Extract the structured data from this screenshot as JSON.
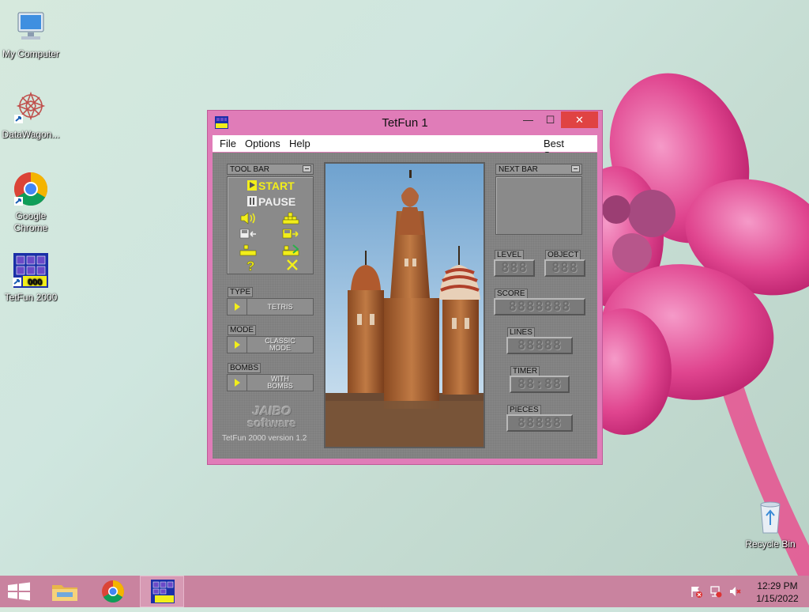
{
  "desktop": {
    "icons": [
      {
        "label": "My Computer"
      },
      {
        "label": "DataWagon..."
      },
      {
        "label": "Google Chrome"
      },
      {
        "label": "TetFun 2000"
      },
      {
        "label": "Recycle Bin"
      }
    ]
  },
  "window": {
    "title": "TetFun 1",
    "app_icon_text": "2000",
    "menu": {
      "file": "File",
      "options": "Options",
      "help": "Help",
      "best_scores": "Best Scores"
    },
    "toolbar": {
      "header": "TOOL BAR",
      "start": "START",
      "pause": "PAUSE",
      "tools": [
        "sound-icon",
        "blocks-icon",
        "load-icon",
        "save-icon",
        "export-icon",
        "import-icon",
        "help-icon",
        "exit-icon"
      ]
    },
    "type": {
      "label": "TYPE",
      "value": "TETRIS"
    },
    "mode": {
      "label": "MODE",
      "value_line1": "CLASSIC",
      "value_line2": "MODE"
    },
    "bombs": {
      "label": "BOMBS",
      "value_line1": "WITH",
      "value_line2": "BOMBS"
    },
    "logo": {
      "line1": "JAIBO",
      "line2": "software"
    },
    "version": "TetFun 2000 version 1.2",
    "next_bar": {
      "header": "NEXT BAR"
    },
    "stats": {
      "level": {
        "label": "LEVEL",
        "display": "888"
      },
      "object": {
        "label": "OBJECT",
        "display": "888"
      },
      "score": {
        "label": "SCORE",
        "display": "8888888"
      },
      "lines": {
        "label": "LINES",
        "display": "88888"
      },
      "timer": {
        "label": "TIMER",
        "display": "88:88"
      },
      "pieces": {
        "label": "PIECES",
        "display": "88888"
      }
    }
  },
  "taskbar": {
    "time": "12:29 PM",
    "date": "1/15/2022"
  },
  "colors": {
    "window_frame": "#e07cb8",
    "close_button": "#e04343",
    "taskbar": "#c9839f",
    "accent_yellow": "#f2ee1a"
  }
}
